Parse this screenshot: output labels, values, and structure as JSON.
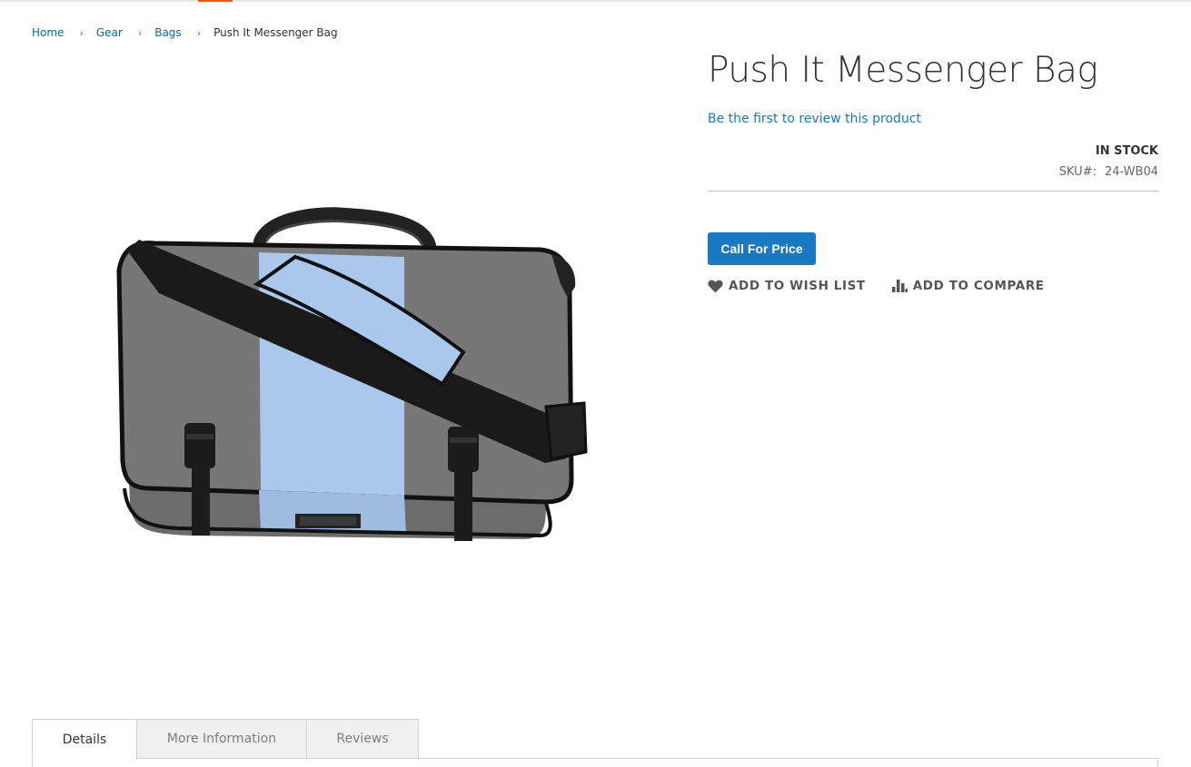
{
  "breadcrumbs": [
    {
      "label": "Home"
    },
    {
      "label": "Gear"
    },
    {
      "label": "Bags"
    },
    {
      "label": "Push It Messenger Bag"
    }
  ],
  "product": {
    "title": "Push It Messenger Bag",
    "review_link": "Be the first to review this product",
    "stock": "IN STOCK",
    "sku_label": "SKU#:",
    "sku_value": "24-WB04",
    "image_icon": "messenger-bag-photo"
  },
  "actions": {
    "call_for_price": "Call For Price",
    "wishlist": {
      "label": "ADD TO WISH LIST",
      "icon": "heart-icon"
    },
    "compare": {
      "label": "ADD TO COMPARE",
      "icon": "bar-chart-icon"
    }
  },
  "tabs": [
    {
      "label": "Details",
      "active": true
    },
    {
      "label": "More Information",
      "active": false
    },
    {
      "label": "Reviews",
      "active": false
    }
  ],
  "colors": {
    "link": "#006bb4",
    "primary_button": "#1979c3",
    "accent": "#ff5501",
    "bag_gray": "#777777",
    "bag_blue": "#a9c8eb"
  }
}
